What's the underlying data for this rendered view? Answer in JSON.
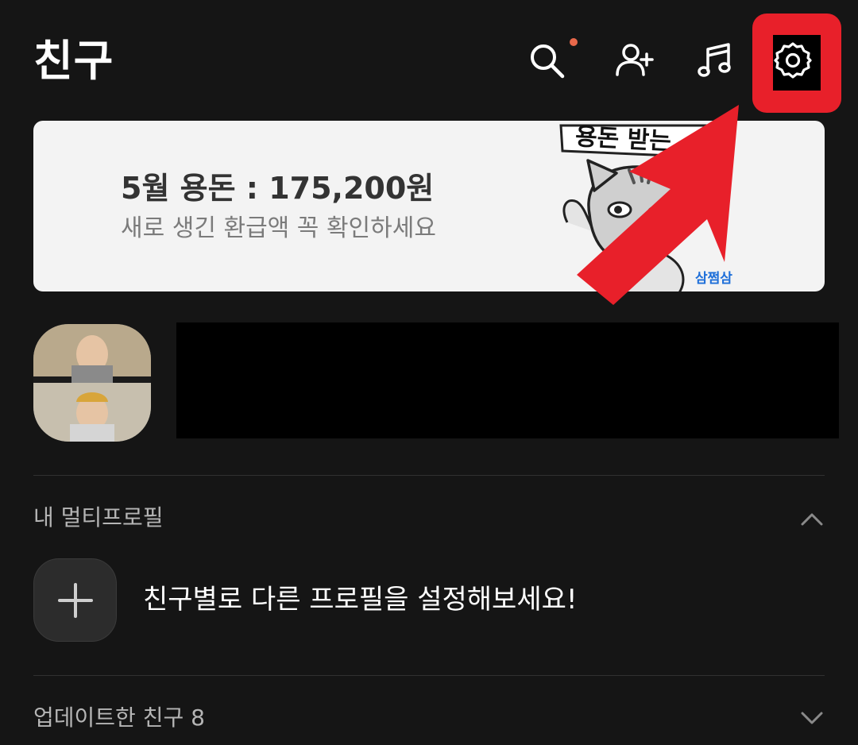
{
  "header": {
    "title": "친구",
    "icons": [
      "search-icon",
      "add-friend-icon",
      "music-icon",
      "settings-icon"
    ],
    "notification_color": "#e8684a"
  },
  "banner": {
    "title": "5월 용돈 : 175,200원",
    "subtitle": "새로 생긴 환급액 꼭 확인하세요",
    "bubble": "용돈 받는",
    "logo": "삼쩜삼"
  },
  "multi_profile": {
    "section_label": "내 멀티프로필",
    "add_text": "친구별로 다른 프로필을 설정해보세요!"
  },
  "updated_friends": {
    "section_label": "업데이트한 친구 8"
  },
  "colors": {
    "background": "#151515",
    "highlight": "#e8202a",
    "banner_bg": "#f3f3f3",
    "logo": "#1e6fd9"
  }
}
